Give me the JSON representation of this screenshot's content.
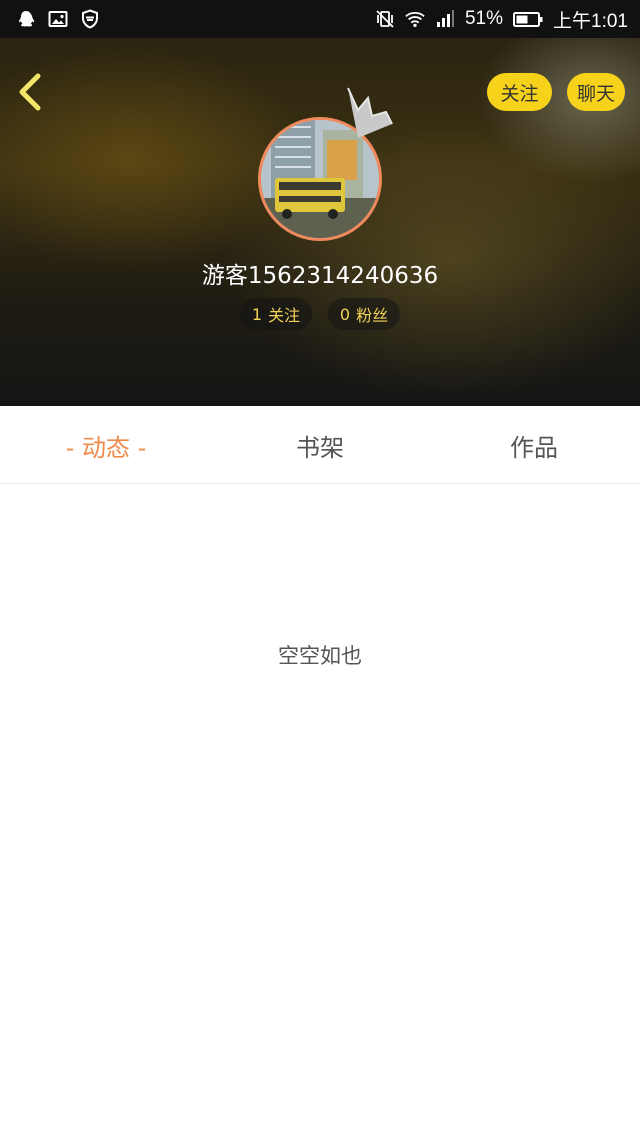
{
  "status_bar": {
    "left_icons": [
      "qq-icon",
      "gallery-icon",
      "shield-icon"
    ],
    "right_icons": [
      "vibrate-off-icon",
      "wifi-icon",
      "signal-icon",
      "battery-icon"
    ],
    "battery": "51%",
    "time": "上午1:01"
  },
  "header": {
    "follow_label": "关注",
    "chat_label": "聊天",
    "username": "游客1562314240636",
    "following_count": "1",
    "following_label": "关注",
    "fans_count": "0",
    "fans_label": "粉丝"
  },
  "tabs": [
    {
      "label": "- 动态 -",
      "active": true
    },
    {
      "label": "书架",
      "active": false
    },
    {
      "label": "作品",
      "active": false
    }
  ],
  "empty_text": "空空如也",
  "colors": {
    "accent_yellow": "#f6d21a",
    "tab_active": "#ef8a4b",
    "avatar_ring": "#f08a5d"
  }
}
